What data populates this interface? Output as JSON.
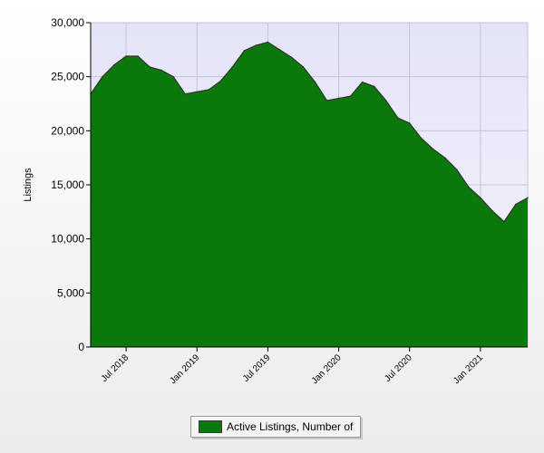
{
  "chart_data": {
    "type": "area",
    "title": "",
    "xlabel": "",
    "ylabel": "Listings",
    "ylim": [
      0,
      30000
    ],
    "yticks": [
      0,
      5000,
      10000,
      15000,
      20000,
      25000,
      30000
    ],
    "ytick_labels": [
      "0",
      "5,000",
      "10,000",
      "15,000",
      "20,000",
      "25,000",
      "30,000"
    ],
    "xticks": [
      {
        "label": "Jul 2018",
        "month_index": 3
      },
      {
        "label": "Jan 2019",
        "month_index": 9
      },
      {
        "label": "Jul 2019",
        "month_index": 15
      },
      {
        "label": "Jan 2020",
        "month_index": 21
      },
      {
        "label": "Jul 2020",
        "month_index": 27
      },
      {
        "label": "Jan 2021",
        "month_index": 33
      }
    ],
    "x": [
      "2018-04",
      "2018-05",
      "2018-06",
      "2018-07",
      "2018-08",
      "2018-09",
      "2018-10",
      "2018-11",
      "2018-12",
      "2019-01",
      "2019-02",
      "2019-03",
      "2019-04",
      "2019-05",
      "2019-06",
      "2019-07",
      "2019-08",
      "2019-09",
      "2019-10",
      "2019-11",
      "2019-12",
      "2020-01",
      "2020-02",
      "2020-03",
      "2020-04",
      "2020-05",
      "2020-06",
      "2020-07",
      "2020-08",
      "2020-09",
      "2020-10",
      "2020-11",
      "2020-12",
      "2021-01",
      "2021-02",
      "2021-03",
      "2021-04",
      "2021-05"
    ],
    "series": [
      {
        "name": "Active Listings, Number of",
        "color": "#0a780a",
        "values": [
          23400,
          25000,
          26100,
          26900,
          26900,
          25900,
          25600,
          25000,
          23400,
          23600,
          23800,
          24600,
          25900,
          27400,
          27900,
          28200,
          27500,
          26800,
          25900,
          24500,
          22800,
          23000,
          23200,
          24500,
          24100,
          22800,
          21200,
          20700,
          19300,
          18300,
          17500,
          16400,
          14800,
          13800,
          12600,
          11600,
          13200,
          13800
        ]
      }
    ],
    "grid": true,
    "legend_position": "bottom-center",
    "plot_background": "#e6e6f8",
    "line_color": "#333333"
  }
}
